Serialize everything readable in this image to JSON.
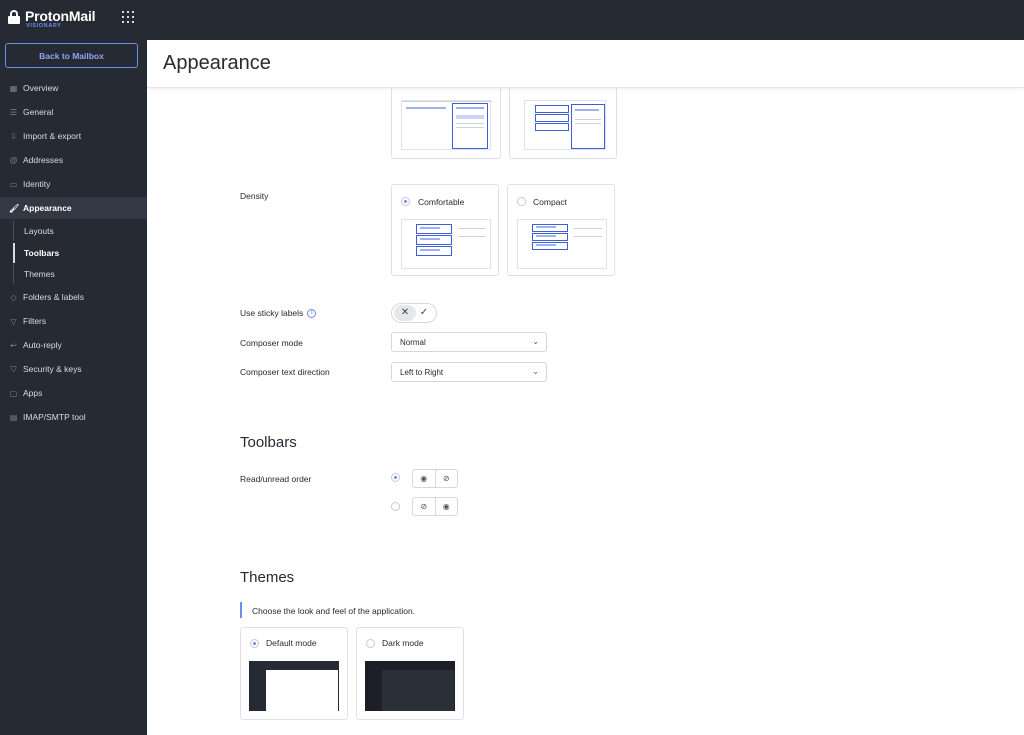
{
  "app": {
    "name": "ProtonMail",
    "tier": "VISIONARY"
  },
  "sidebar": {
    "back_label": "Back to Mailbox",
    "items": [
      {
        "label": "Overview",
        "icon": "grid-icon"
      },
      {
        "label": "General",
        "icon": "sliders-icon"
      },
      {
        "label": "Import & export",
        "icon": "import-icon"
      },
      {
        "label": "Addresses",
        "icon": "at-icon"
      },
      {
        "label": "Identity",
        "icon": "id-card-icon"
      },
      {
        "label": "Appearance",
        "icon": "paint-roller-icon",
        "active": true
      },
      {
        "label": "Folders & labels",
        "icon": "tag-icon"
      },
      {
        "label": "Filters",
        "icon": "filter-icon"
      },
      {
        "label": "Auto-reply",
        "icon": "reply-icon"
      },
      {
        "label": "Security & keys",
        "icon": "shield-icon"
      },
      {
        "label": "Apps",
        "icon": "apps-icon"
      },
      {
        "label": "IMAP/SMTP tool",
        "icon": "server-icon"
      }
    ],
    "sub_items": [
      {
        "label": "Layouts"
      },
      {
        "label": "Toolbars",
        "active": true
      },
      {
        "label": "Themes"
      }
    ]
  },
  "main": {
    "title": "Appearance",
    "density": {
      "label": "Density",
      "options": [
        {
          "label": "Comfortable",
          "checked": true
        },
        {
          "label": "Compact",
          "checked": false
        }
      ]
    },
    "sticky_labels": {
      "label": "Use sticky labels"
    },
    "composer_mode": {
      "label": "Composer mode",
      "value": "Normal"
    },
    "composer_direction": {
      "label": "Composer text direction",
      "value": "Left to Right"
    },
    "toolbars": {
      "title": "Toolbars",
      "read_unread_label": "Read/unread order"
    },
    "themes": {
      "title": "Themes",
      "description": "Choose the look and feel of the application.",
      "options": [
        {
          "label": "Default mode",
          "checked": true
        },
        {
          "label": "Dark mode",
          "checked": false
        }
      ]
    }
  },
  "colors": {
    "accent": "#6d8cf0",
    "sidebar_bg": "#262a33",
    "layout_blue": "#3d5fd9"
  }
}
